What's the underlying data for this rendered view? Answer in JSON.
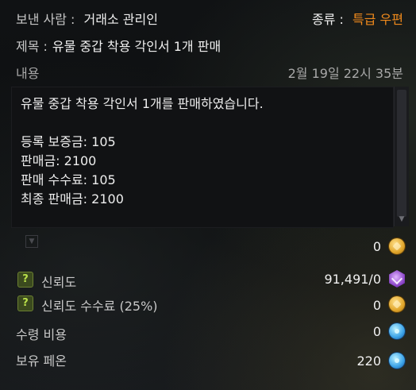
{
  "header": {
    "sender_label": "보낸 사람 :",
    "sender_value": "거래소 관리인",
    "type_label": "종류 :",
    "type_value": "특급 우편"
  },
  "subject": {
    "label": "제목 :",
    "value": "유물 중갑 착용 각인서 1개 판매"
  },
  "content": {
    "label": "내용",
    "timestamp": "2월 19일 22시 35분",
    "lines": [
      "유물 중갑 착용 각인서 1개를 판매하였습니다.",
      "",
      "등록 보증금: 105",
      "판매금: 2100",
      "판매 수수료: 105",
      "최종 판매금: 2100"
    ]
  },
  "attachments": {
    "gold_amount": "0",
    "trust": {
      "label": "신뢰도",
      "value": "91,491/0",
      "help": "?"
    },
    "trust_fee": {
      "label": "신뢰도 수수료 (25%)",
      "value": "0",
      "help": "?"
    },
    "receive_cost": {
      "label": "수령 비용",
      "value": "0"
    },
    "owned_pheon": {
      "label": "보유 페온",
      "value": "220"
    }
  },
  "colors": {
    "accent_orange": "#f08a1c",
    "help_green": "#b9e04a"
  },
  "icons": {
    "gold": "gold-coin-icon",
    "trust": "trust-badge-icon",
    "pheon": "pheon-crystal-icon",
    "help": "help-icon"
  }
}
